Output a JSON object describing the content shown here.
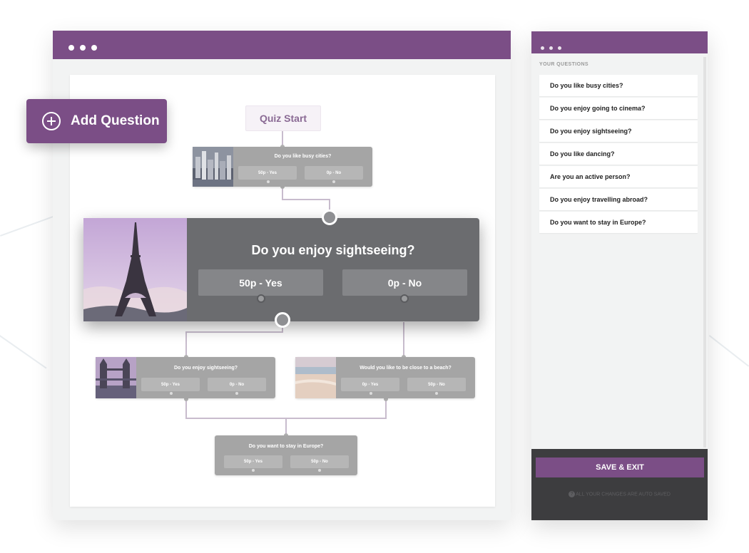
{
  "colors": {
    "accent": "#7b4e86",
    "node_gray": "#a5a5a5",
    "node_dark": "#6b6c6f",
    "footer": "#3d3d3f"
  },
  "add_question": {
    "label": "Add Question",
    "icon": "plus-circle-icon"
  },
  "flow": {
    "start_label": "Quiz Start",
    "nodes": {
      "busy_cities": {
        "question": "Do you like busy cities?",
        "yes": "50p - Yes",
        "no": "0p - No",
        "image": "city-skyline"
      },
      "sightseeing_main": {
        "question": "Do you enjoy sightseeing?",
        "yes": "50p - Yes",
        "no": "0p - No",
        "image": "eiffel-tower"
      },
      "sightseeing_left": {
        "question": "Do you enjoy sightseeing?",
        "yes": "50p - Yes",
        "no": "0p - No",
        "image": "tower-bridge"
      },
      "beach": {
        "question": "Would you like to be close to a beach?",
        "yes": "0p - Yes",
        "no": "50p - No",
        "image": "beach"
      },
      "europe": {
        "question": "Do you want to stay in Europe?",
        "yes": "50p - Yes",
        "no": "50p - No"
      }
    }
  },
  "sidebar": {
    "heading": "YOUR QUESTIONS",
    "questions": [
      "Do you like busy cities?",
      "Do you enjoy going to cinema?",
      "Do you enjoy sightseeing?",
      "Do you like dancing?",
      "Are you an active person?",
      "Do you enjoy travelling abroad?",
      "Do you want to stay in Europe?"
    ],
    "save_label": "SAVE & EXIT",
    "autosave_text": "ALL YOUR CHANGES ARE AUTO SAVED"
  }
}
